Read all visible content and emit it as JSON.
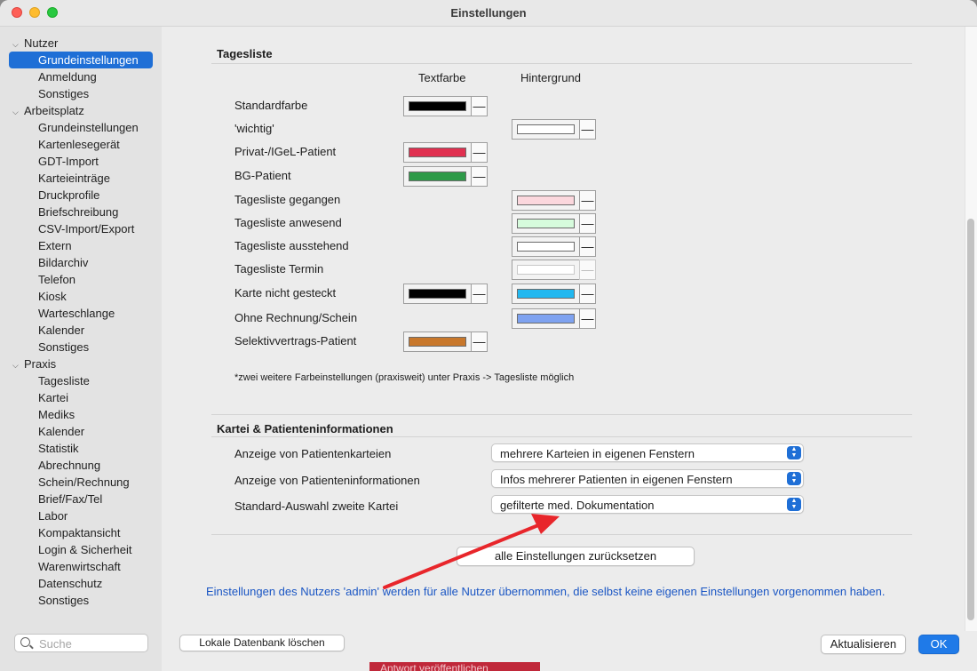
{
  "window": {
    "title": "Einstellungen"
  },
  "sidebar": {
    "groups": [
      {
        "label": "Nutzer",
        "items": [
          "Grundeinstellungen",
          "Anmeldung",
          "Sonstiges"
        ]
      },
      {
        "label": "Arbeitsplatz",
        "items": [
          "Grundeinstellungen",
          "Kartenlesegerät",
          "GDT-Import",
          "Karteieinträge",
          "Druckprofile",
          "Briefschreibung",
          "CSV-Import/Export",
          "Extern",
          "Bildarchiv",
          "Telefon",
          "Kiosk",
          "Warteschlange",
          "Kalender",
          "Sonstiges"
        ]
      },
      {
        "label": "Praxis",
        "items": [
          "Tagesliste",
          "Kartei",
          "Mediks",
          "Kalender",
          "Statistik",
          "Abrechnung",
          "Schein/Rechnung",
          "Brief/Fax/Tel",
          "Labor",
          "Kompaktansicht",
          "Login & Sicherheit",
          "Warenwirtschaft",
          "Datenschutz",
          "Sonstiges"
        ]
      }
    ],
    "selected": "Nutzer / Grundeinstellungen",
    "search_placeholder": "Suche"
  },
  "tagesliste": {
    "title": "Tagesliste",
    "col_textfarbe": "Textfarbe",
    "col_hintergrund": "Hintergrund",
    "rows": [
      {
        "label": "Standardfarbe",
        "text_color": "#000000",
        "bg_color": null
      },
      {
        "label": "'wichtig'",
        "text_color": null,
        "bg_color": "#ffffff"
      },
      {
        "label": "Privat-/IGeL-Patient",
        "text_color": "#e03050",
        "bg_color": null
      },
      {
        "label": "BG-Patient",
        "text_color": "#2e9a48",
        "bg_color": null
      },
      {
        "label": "Tagesliste gegangen",
        "text_color": null,
        "bg_color": "#fbd7dd"
      },
      {
        "label": "Tagesliste anwesend",
        "text_color": null,
        "bg_color": "#d6fbdc"
      },
      {
        "label": "Tagesliste ausstehend",
        "text_color": null,
        "bg_color": "#ffffff"
      },
      {
        "label": "Tagesliste Termin",
        "text_color": null,
        "bg_color": "#ffffff",
        "disabled": true
      },
      {
        "label": "Karte nicht gesteckt",
        "text_color": "#000000",
        "bg_color": "#22b8f0"
      },
      {
        "label": "Ohne Rechnung/Schein",
        "text_color": null,
        "bg_color": "#7ea2f0"
      },
      {
        "label": "Selektivvertrags-Patient",
        "text_color": "#c8782c",
        "bg_color": null
      }
    ],
    "minus_label": "—",
    "note": "*zwei weitere Farbeinstellungen (praxisweit) unter Praxis -> Tagesliste möglich"
  },
  "kartei": {
    "title": "Kartei & Patienteninformationen",
    "rows": [
      {
        "label": "Anzeige von Patientenkarteien",
        "value": "mehrere Karteien in eigenen Fenstern"
      },
      {
        "label": "Anzeige von Patienteninformationen",
        "value": "Infos mehrerer Patienten in eigenen Fenstern"
      },
      {
        "label": "Standard-Auswahl zweite Kartei",
        "value": "gefilterte med. Dokumentation"
      }
    ]
  },
  "reset_button": "alle Einstellungen zurücksetzen",
  "info_text": "Einstellungen des Nutzers 'admin' werden für alle Nutzer übernommen, die selbst keine eigenen Einstellungen vorgenommen haben.",
  "footer": {
    "delete_db_button": "Lokale Datenbank löschen",
    "refresh_button": "Aktualisieren",
    "ok_button": "OK"
  },
  "background_window": {
    "button_label": "Antwort veröffentlichen"
  },
  "colors": {
    "accent": "#1f6fd6",
    "annotation_arrow": "#e8262b",
    "info_text": "#1a56c4"
  }
}
